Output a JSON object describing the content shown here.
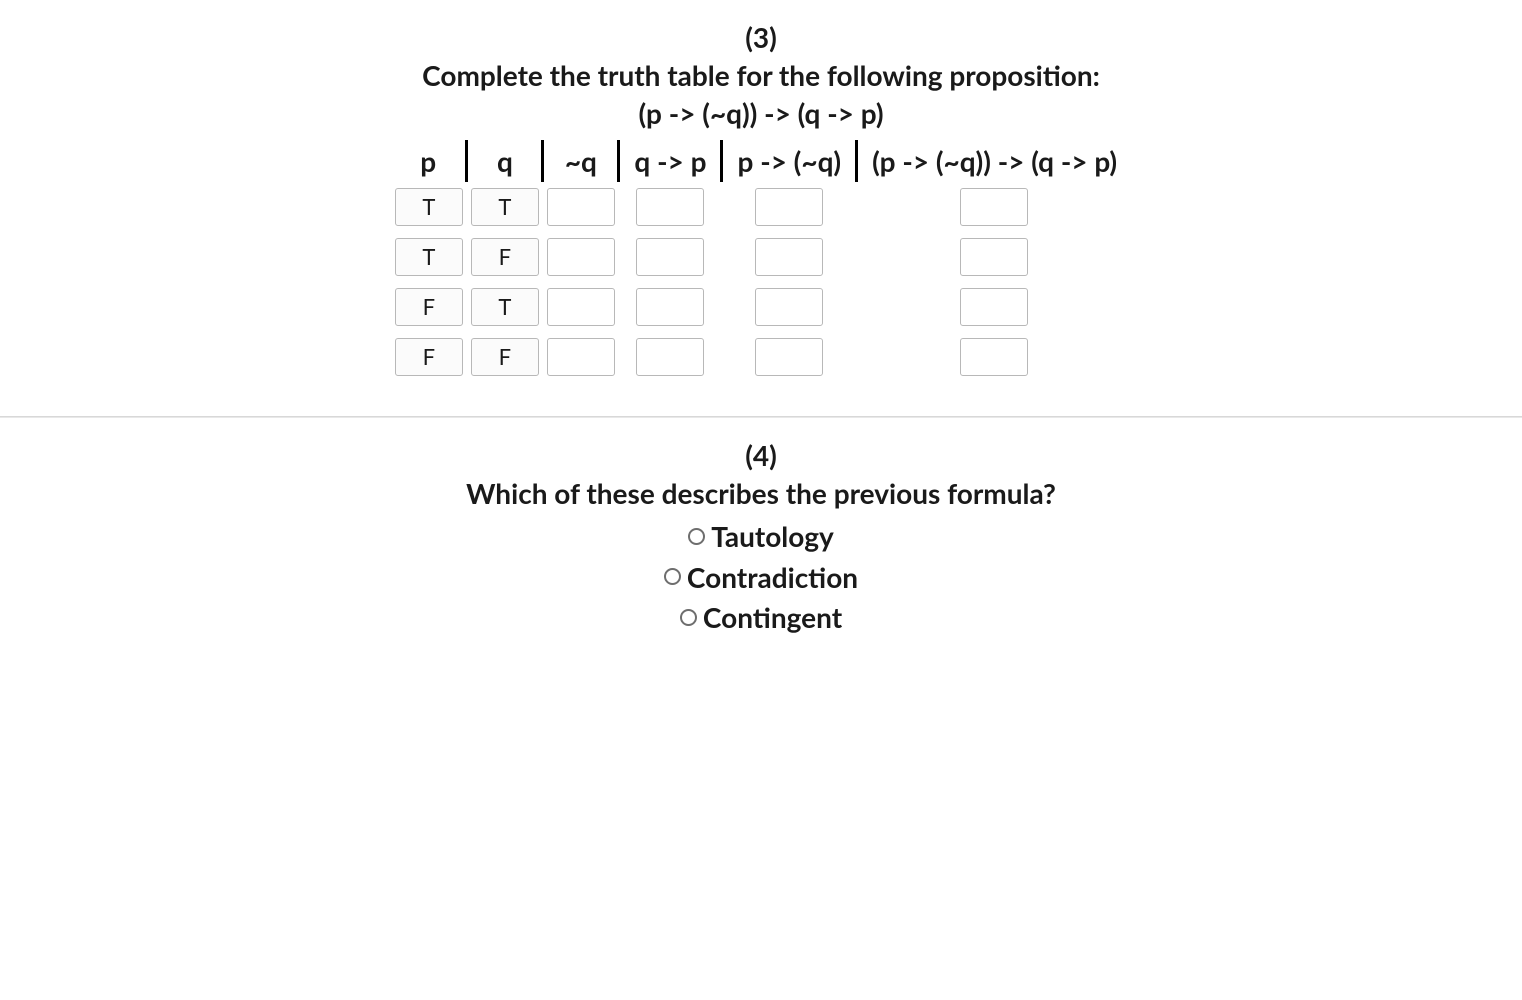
{
  "q3": {
    "number": "(3)",
    "prompt": "Complete the truth table for the following proposition:",
    "formula": "(p -> (~q)) -> (q -> p)",
    "headers": [
      "p",
      "q",
      "~q",
      "q -> p",
      "p -> (~q)",
      "(p -> (~q)) -> (q -> p)"
    ],
    "rows": [
      {
        "p": "T",
        "q": "T",
        "notq": "",
        "q_imp_p": "",
        "p_imp_notq": "",
        "final": ""
      },
      {
        "p": "T",
        "q": "F",
        "notq": "",
        "q_imp_p": "",
        "p_imp_notq": "",
        "final": ""
      },
      {
        "p": "F",
        "q": "T",
        "notq": "",
        "q_imp_p": "",
        "p_imp_notq": "",
        "final": ""
      },
      {
        "p": "F",
        "q": "F",
        "notq": "",
        "q_imp_p": "",
        "p_imp_notq": "",
        "final": ""
      }
    ]
  },
  "q4": {
    "number": "(4)",
    "prompt": "Which of these describes the previous formula?",
    "options": [
      "Tautology",
      "Contradiction",
      "Contingent"
    ]
  }
}
